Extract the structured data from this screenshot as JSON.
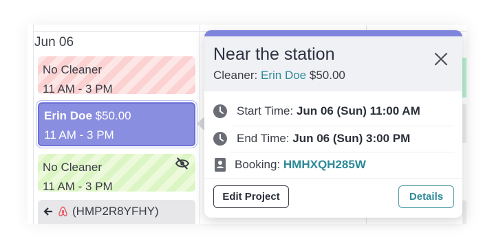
{
  "calendar": {
    "day_label": "Jun 06",
    "events": [
      {
        "name": "No Cleaner",
        "time": "11 AM - 3 PM"
      },
      {
        "name": "Erin Doe",
        "price": "$50.00",
        "time": "11 AM - 3 PM"
      },
      {
        "name": "No Cleaner",
        "time": "11 AM - 3 PM"
      }
    ],
    "booking_event": {
      "code": "(HMP2R8YFHY)",
      "icon": "airbnb-icon"
    }
  },
  "popover": {
    "title": "Near the station",
    "cleaner_label": "Cleaner:",
    "cleaner_name": "Erin Doe",
    "price": "$50.00",
    "start_label": "Start Time:",
    "start_value": "Jun 06 (Sun) 11:00 AM",
    "end_label": "End Time:",
    "end_value": "Jun 06 (Sun) 3:00 PM",
    "booking_label": "Booking:",
    "booking_code": "HMHXQH285W",
    "edit_button": "Edit Project",
    "details_button": "Details"
  },
  "colors": {
    "accent": "#7f85dc",
    "selected_event": "#8a8ee0",
    "link": "#2f8a98"
  }
}
